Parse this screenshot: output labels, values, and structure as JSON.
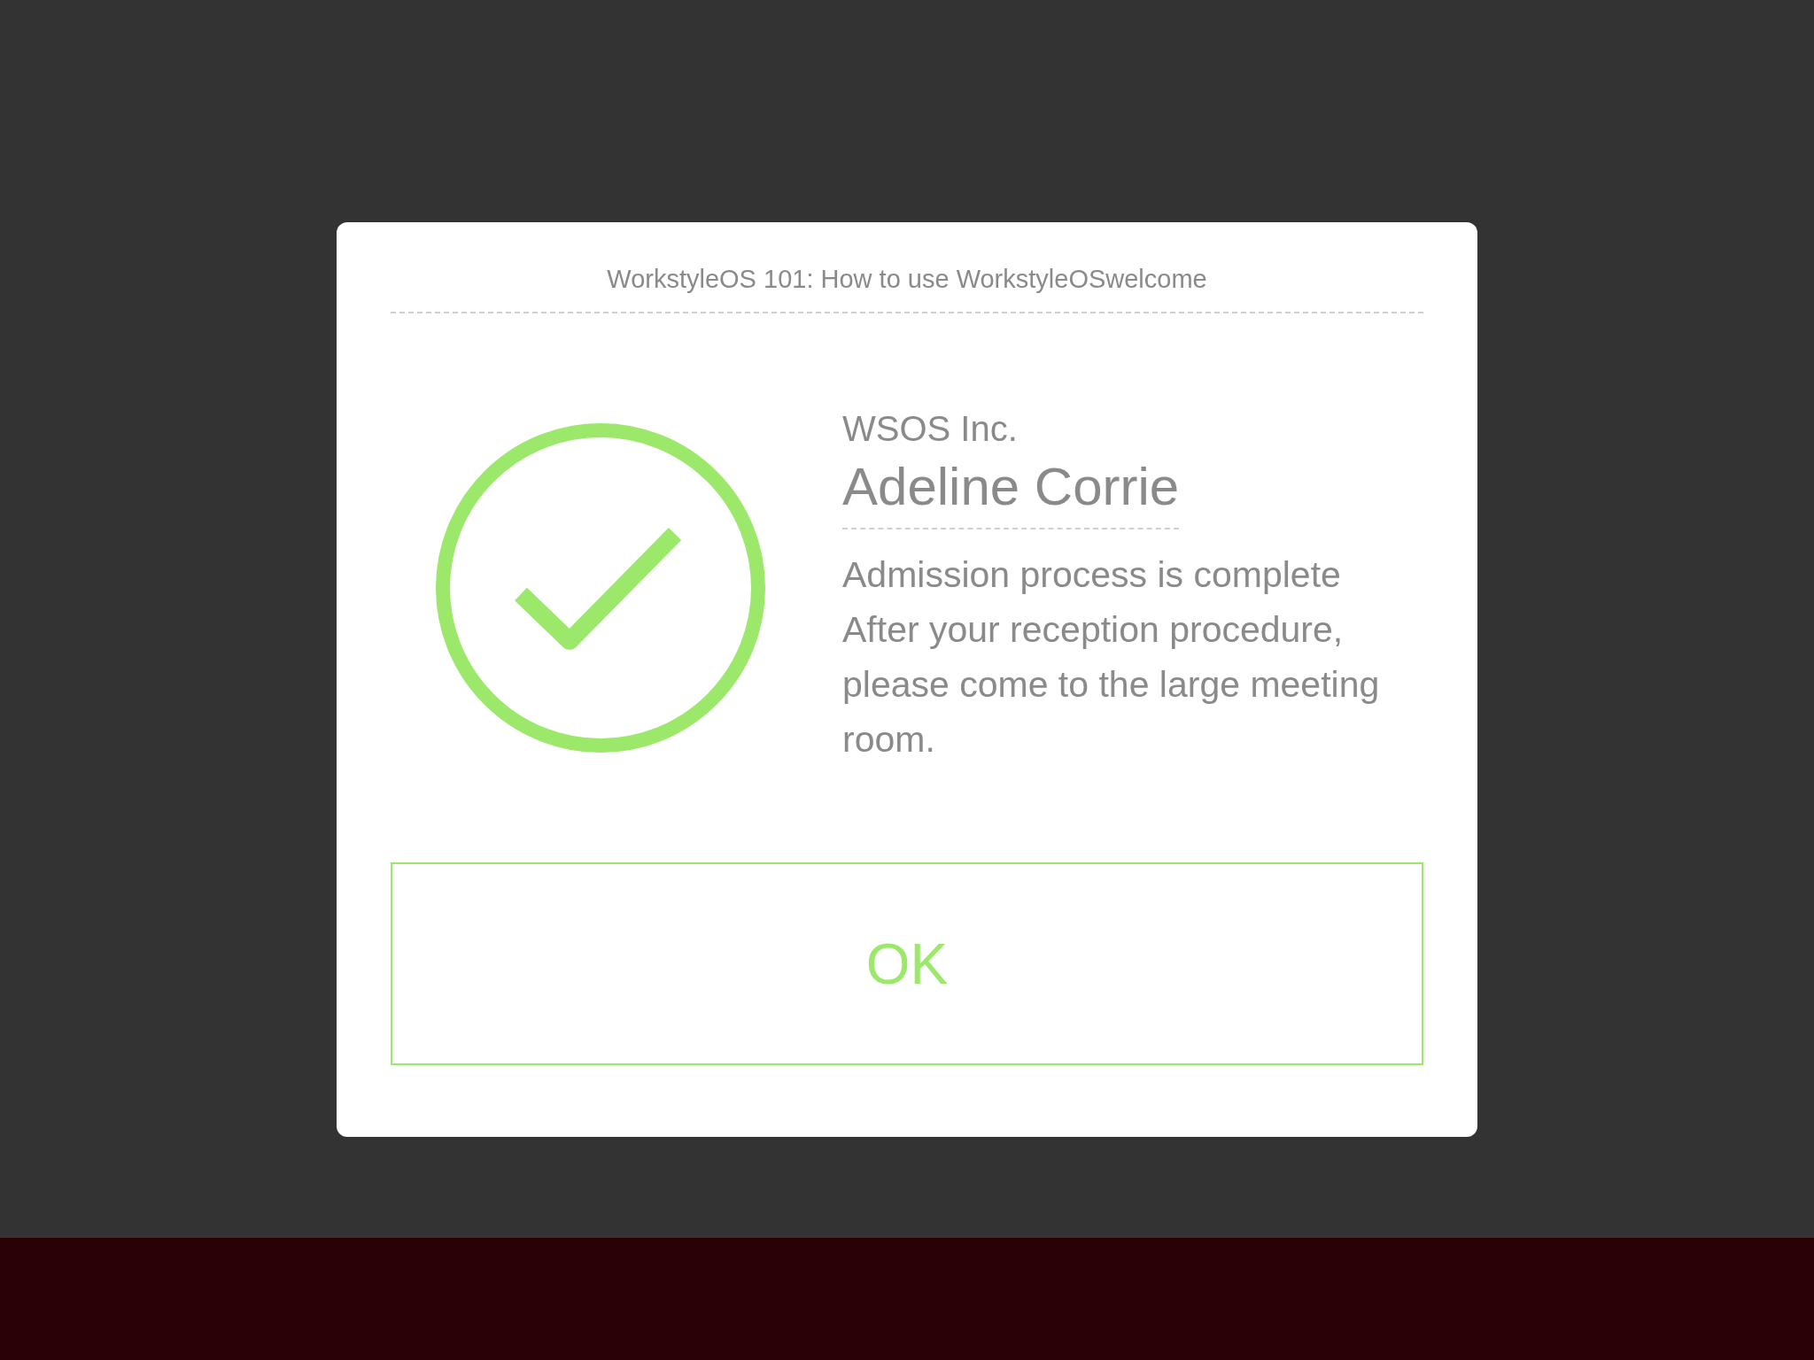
{
  "dialog": {
    "title": "WorkstyleOS 101: How to use WorkstyleOSwelcome",
    "kind": "success",
    "company": "WSOS Inc.",
    "name": "Adeline Corrie",
    "messages": [
      "Admission process is complete",
      "After your reception procedure, please come to the large meeting room."
    ],
    "button": "OK"
  }
}
